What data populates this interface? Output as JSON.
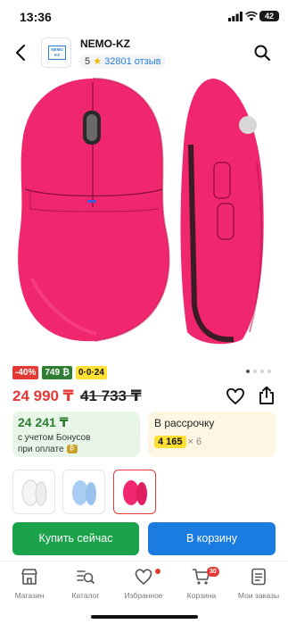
{
  "status_bar": {
    "time": "13:36",
    "battery": "42"
  },
  "header": {
    "store_name": "NEMO-KZ",
    "logo_text": "NEMO KZ",
    "rating": "5",
    "reviews": "32801 отзыв",
    "icons": {
      "back": "chevron-left-icon",
      "search": "search-icon"
    }
  },
  "gallery": {
    "product_color": "#f0266e",
    "page_count": 4,
    "current_page": 0
  },
  "badges": {
    "discount": "-40%",
    "bonus": "749 ₿",
    "installment": "0·0·24"
  },
  "price": {
    "current": "24 990 ₸",
    "old": "41 733 ₸"
  },
  "bonus_card": {
    "amount": "24 241 ₸",
    "line1": "с учетом Бонусов",
    "line2": "при оплате",
    "bonus_icon": "₿"
  },
  "installment_card": {
    "label": "В рассрочку",
    "monthly": "4 165",
    "months": "× 6"
  },
  "variants": [
    {
      "color": "#f4f5f6",
      "selected": false
    },
    {
      "color": "#a9cdf2",
      "selected": false
    },
    {
      "color": "#f0266e",
      "selected": true
    }
  ],
  "buttons": {
    "buy_now": "Купить сейчас",
    "add_to_cart": "В корзину"
  },
  "nav": {
    "items": [
      {
        "label": "Магазин",
        "icon": "store-icon"
      },
      {
        "label": "Каталог",
        "icon": "catalog-icon"
      },
      {
        "label": "Избранное",
        "icon": "heart-icon"
      },
      {
        "label": "Корзина",
        "icon": "cart-icon"
      },
      {
        "label": "Мои заказы",
        "icon": "orders-icon"
      }
    ],
    "cart_count": "30"
  },
  "colors": {
    "accent_red": "#e53935",
    "buy_green": "#1aa34a",
    "cart_blue": "#1a7be0",
    "bonus_green": "#2e7d32"
  }
}
